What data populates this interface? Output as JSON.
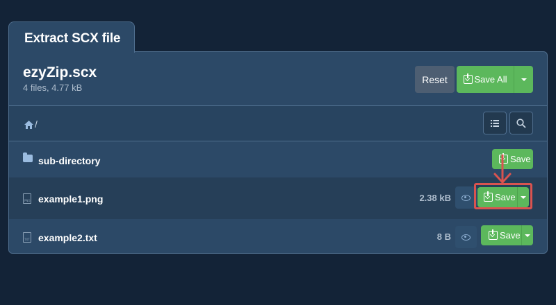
{
  "tab": {
    "title": "Extract SCX file"
  },
  "archive": {
    "name": "ezyZip.scx",
    "summary": "4 files, 4.77 kB"
  },
  "actions": {
    "reset_label": "Reset",
    "save_all_label": "Save All"
  },
  "nav": {
    "path": "/"
  },
  "rows": [
    {
      "type": "folder",
      "name": "sub-directory",
      "size": "",
      "save_label": "Save",
      "icon": "folder-icon"
    },
    {
      "type": "file",
      "name": "example1.png",
      "size": "2.38 kB",
      "save_label": "Save",
      "icon_label": "PNG",
      "icon": "png-file-icon"
    },
    {
      "type": "file",
      "name": "example2.txt",
      "size": "8 B",
      "save_label": "Save",
      "icon_label": "TXT",
      "icon": "txt-file-icon"
    }
  ],
  "colors": {
    "background": "#132337",
    "panel": "#2c4967",
    "save_green": "#5cb85c",
    "highlight": "#d9534f"
  }
}
